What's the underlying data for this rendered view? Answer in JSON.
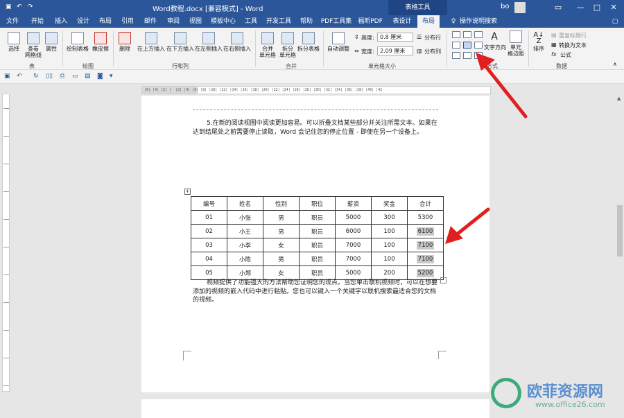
{
  "titlebar": {
    "title": "Word教程.docx [兼容模式] - Word",
    "context_tab": "表格工具",
    "user": "bo",
    "minimize": "—",
    "restore": "□",
    "close": "✕"
  },
  "tabs": [
    "文件",
    "开始",
    "插入",
    "设计",
    "布局",
    "引用",
    "邮件",
    "审阅",
    "视图",
    "模板中心",
    "工具",
    "开发工具",
    "帮助",
    "PDF工具集",
    "福昕PDF",
    "表设计",
    "布局"
  ],
  "tell_me": "操作说明搜索",
  "share": "共享",
  "ribbon": {
    "table_group": {
      "select": "选择",
      "gridlines": "查看\n网格线",
      "properties": "属性",
      "label": "表"
    },
    "draw_group": {
      "draw_table": "绘制表格",
      "eraser": "橡皮擦",
      "label": "绘图"
    },
    "rowcol_group": {
      "delete": "删除",
      "insert_above": "在上方插入",
      "insert_below": "在下方插入",
      "insert_left": "在左侧插入",
      "insert_right": "在右侧插入",
      "label": "行和列"
    },
    "merge_group": {
      "merge": "合并\n单元格",
      "split": "拆分\n单元格",
      "split_table": "拆分表格",
      "label": "合并"
    },
    "size_group": {
      "autofit": "自动调整",
      "height_label": "高度:",
      "height_value": "0.8 厘米",
      "width_label": "宽度:",
      "width_value": "2.09 厘米",
      "dist_rows": "分布行",
      "dist_cols": "分布列",
      "label": "单元格大小"
    },
    "align_group": {
      "text_direction": "文字方向",
      "margins": "单元\n格边距",
      "label": "对齐方式",
      "label_visible": "方式"
    },
    "data_group": {
      "sort": "排序",
      "repeat_header": "重复标题行",
      "convert": "转换为文本",
      "formula": "公式",
      "label": "数据"
    }
  },
  "document": {
    "para1": "5.在新的阅读视图中阅读更加容易。可以折叠文档某些部分并关注所需文本。如果在达到结尾处之前需要停止读取，Word 会记住您的停止位置 - 即使在另一个设备上。",
    "para2": "视频提供了功能强大的方法帮助您证明您的观点。当您单击联机视频时，可以在想要添加的视频的嵌入代码中进行粘贴。您也可以键入一个关键字以联机搜索最适合您的文档的视频。",
    "table": {
      "headers": [
        "编号",
        "姓名",
        "性别",
        "职位",
        "薪资",
        "奖金",
        "合计"
      ],
      "rows": [
        [
          "01",
          "小张",
          "男",
          "职员",
          "5000",
          "300",
          "5300"
        ],
        [
          "02",
          "小王",
          "男",
          "职员",
          "6000",
          "100",
          "6100"
        ],
        [
          "03",
          "小李",
          "女",
          "职员",
          "7000",
          "100",
          "7100"
        ],
        [
          "04",
          "小陈",
          "男",
          "职员",
          "7000",
          "100",
          "7100"
        ],
        [
          "05",
          "小郑",
          "女",
          "职员",
          "5000",
          "200",
          "5200"
        ]
      ]
    }
  },
  "watermark": {
    "text": "欧菲资源网",
    "url": "www.office26.com"
  },
  "colors": {
    "brand": "#2b579a",
    "arrow": "#e02020",
    "highlight": "#c8c8c8"
  }
}
